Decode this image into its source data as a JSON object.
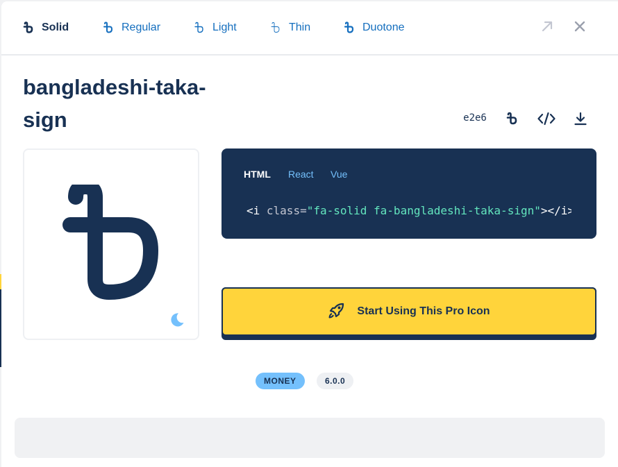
{
  "styles": {
    "tabs": [
      {
        "label": "Solid",
        "active": true
      },
      {
        "label": "Regular",
        "active": false
      },
      {
        "label": "Light",
        "active": false
      },
      {
        "label": "Thin",
        "active": false
      },
      {
        "label": "Duotone",
        "active": false
      }
    ]
  },
  "actions": {
    "open_icon": "arrow-up-right-icon",
    "close_icon": "xmark-icon"
  },
  "icon": {
    "name": "bangladeshi-taka-sign",
    "unicode": "e2e6",
    "toolbar_icons": [
      "bangladeshi-taka-sign-icon",
      "code-icon",
      "download-icon"
    ]
  },
  "code": {
    "tabs": [
      "HTML",
      "React",
      "Vue"
    ],
    "active_tab": "HTML",
    "open": "<i ",
    "attr": "class=",
    "value": "\"fa-solid fa-bangladeshi-taka-sign\"",
    "close": "></i>"
  },
  "cta": {
    "label": "Start Using This Pro Icon",
    "icon": "rocket-icon"
  },
  "meta": {
    "category": "MONEY",
    "version": "6.0.0"
  },
  "colors": {
    "navy": "#183153",
    "accent_blue": "#146ebe",
    "light_blue": "#74c0fc",
    "yellow": "#ffd43b",
    "code_string": "#63e6be"
  }
}
